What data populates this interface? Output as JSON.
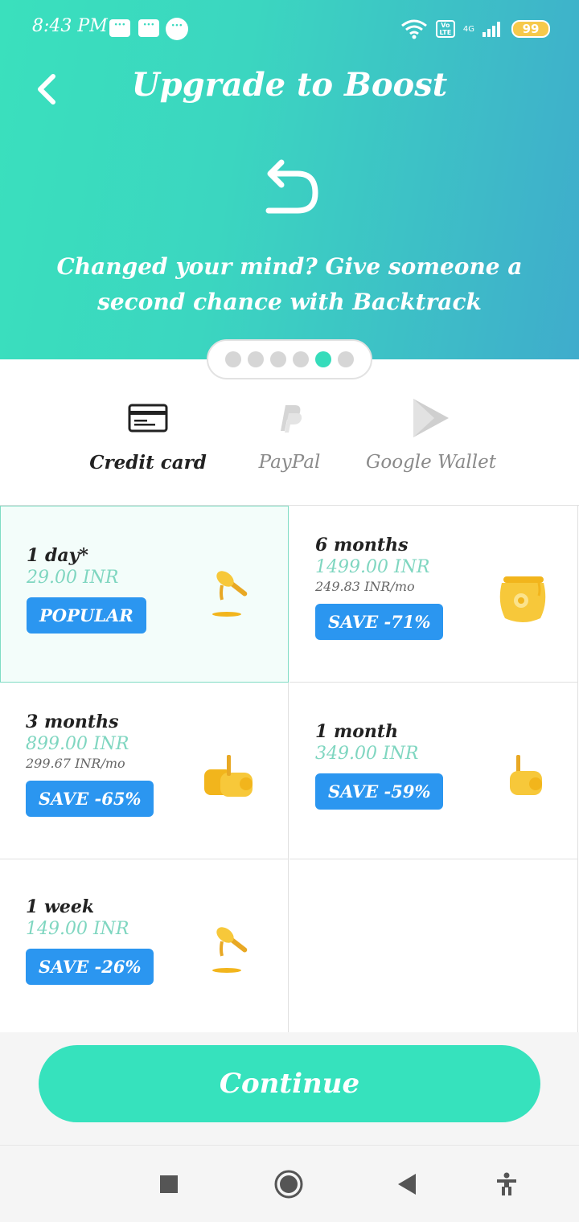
{
  "status_bar": {
    "time": "8:43 PM",
    "battery": "99",
    "network": "4G",
    "volte": "Vo LTE"
  },
  "header": {
    "title": "Upgrade to Boost",
    "tagline": "Changed your mind? Give someone a second chance with Backtrack"
  },
  "carousel": {
    "total": 6,
    "active_index": 4
  },
  "payment_methods": [
    {
      "label": "Credit card",
      "icon": "credit-card-icon",
      "selected": true
    },
    {
      "label": "PayPal",
      "icon": "paypal-icon",
      "selected": false
    },
    {
      "label": "Google Wallet",
      "icon": "google-wallet-icon",
      "selected": false
    }
  ],
  "plans": [
    {
      "name": "1 day*",
      "price": "29.00 INR",
      "per": "",
      "badge": "POPULAR",
      "icon": "honey-dipper-icon",
      "selected": true
    },
    {
      "name": "6 months",
      "price": "1499.00 INR",
      "per": "249.83 INR/mo",
      "badge": "SAVE -71%",
      "icon": "honey-pot-icon",
      "selected": false
    },
    {
      "name": "3 months",
      "price": "899.00 INR",
      "per": "299.67 INR/mo",
      "badge": "SAVE -65%",
      "icon": "honey-jars-icon",
      "selected": false
    },
    {
      "name": "1 month",
      "price": "349.00 INR",
      "per": "",
      "badge": "SAVE -59%",
      "icon": "honey-jar-icon",
      "selected": false
    },
    {
      "name": "1 week",
      "price": "149.00 INR",
      "per": "",
      "badge": "SAVE -26%",
      "icon": "honey-dipper-icon",
      "selected": false
    }
  ],
  "continue_label": "Continue",
  "colors": {
    "accent": "#36e2bd",
    "badge": "#2b96f0",
    "price": "#7fd6c0",
    "header_gradient_start": "#3ae0bd",
    "header_gradient_end": "#3faccc"
  }
}
